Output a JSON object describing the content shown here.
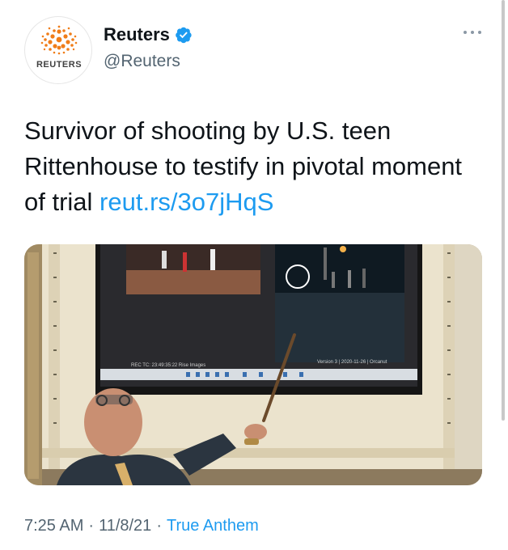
{
  "author": {
    "display_name": "Reuters",
    "handle": "@Reuters",
    "verified": true,
    "avatar_word": "REUTERS",
    "avatar_color": "#f07d19"
  },
  "more_icon": "more-horizontal-icon",
  "tweet": {
    "text": "Survivor of shooting by U.S. teen Rittenhouse to testify in pivotal moment of trial",
    "link": "reut.rs/3o7jHqS",
    "link_color": "#1d9bf0"
  },
  "media": {
    "screen": {
      "left_caption": "REC TC: 23:49:35:22  Rise Images",
      "right_caption": "Version 3 | 2020-11-26 | Orcanut"
    }
  },
  "footer": {
    "time": "7:25 AM",
    "date": "11/8/21",
    "separator": "·",
    "source": "True Anthem"
  }
}
